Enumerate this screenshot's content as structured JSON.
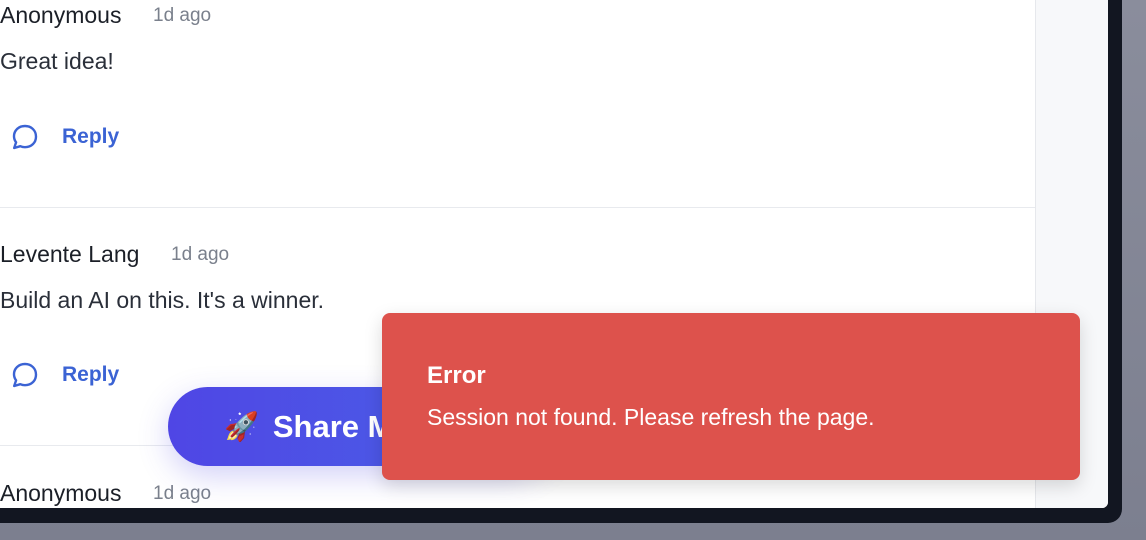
{
  "comments": [
    {
      "author": "Anonymous",
      "time": "1d ago",
      "body": "Great idea!",
      "reply_label": "Reply"
    },
    {
      "author": "Levente Lang",
      "time": "1d ago",
      "body": "Build an AI on this. It's a winner.",
      "reply_label": "Reply"
    },
    {
      "author": "Anonymous",
      "time": "1d ago"
    }
  ],
  "share": {
    "icon": "rocket-icon",
    "emoji": "🚀",
    "label": "Share M"
  },
  "toast": {
    "title": "Error",
    "message": "Session not found. Please refresh the page.",
    "color": "#dd524c"
  },
  "colors": {
    "accent": "#3b63d4",
    "share_gradient_start": "#4f46e5",
    "share_gradient_end": "#4a63e6",
    "window_frame": "#121621"
  }
}
